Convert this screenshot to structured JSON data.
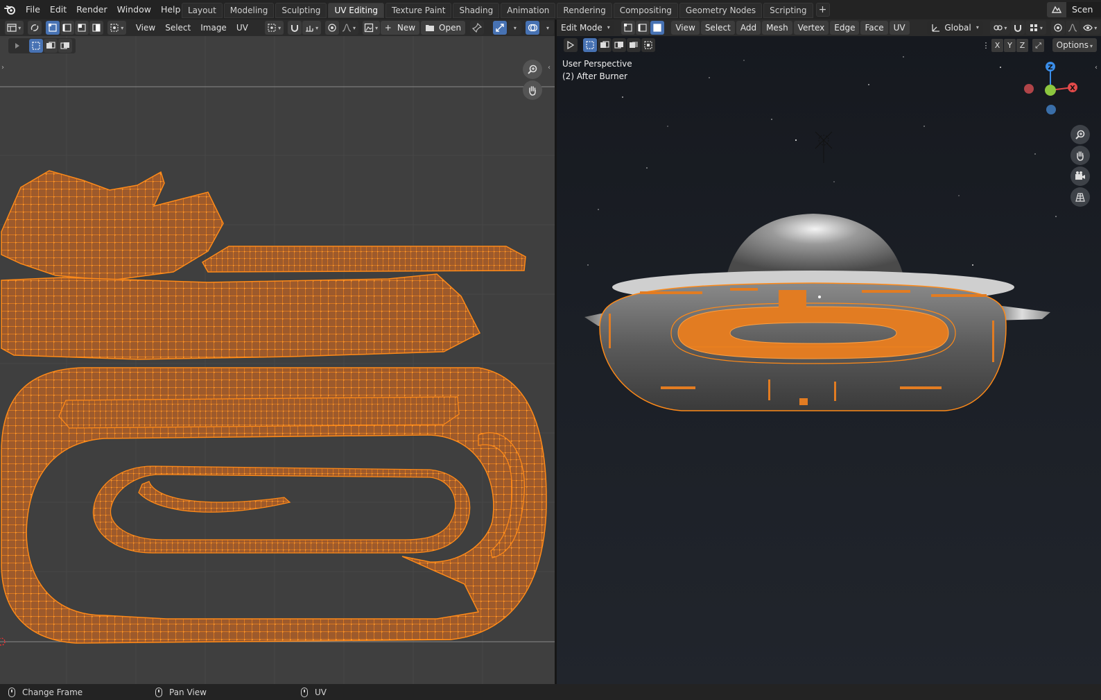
{
  "menu": {
    "file": "File",
    "edit": "Edit",
    "render": "Render",
    "window": "Window",
    "help": "Help"
  },
  "workspace_tabs": [
    {
      "label": "Layout",
      "active": false
    },
    {
      "label": "Modeling",
      "active": false
    },
    {
      "label": "Sculpting",
      "active": false
    },
    {
      "label": "UV Editing",
      "active": true
    },
    {
      "label": "Texture Paint",
      "active": false
    },
    {
      "label": "Shading",
      "active": false
    },
    {
      "label": "Animation",
      "active": false
    },
    {
      "label": "Rendering",
      "active": false
    },
    {
      "label": "Compositing",
      "active": false
    },
    {
      "label": "Geometry Nodes",
      "active": false
    },
    {
      "label": "Scripting",
      "active": false
    }
  ],
  "workspace_add": "+",
  "scene": {
    "label": "Scen"
  },
  "uv_header": {
    "view": "View",
    "select": "Select",
    "image": "Image",
    "uv": "UV",
    "new": "New",
    "new_prefix": "+",
    "open": "Open"
  },
  "viewport_header": {
    "mode": "Edit Mode",
    "view": "View",
    "select": "Select",
    "add": "Add",
    "mesh": "Mesh",
    "vertex": "Vertex",
    "edge": "Edge",
    "face": "Face",
    "uv": "UV",
    "orientation": "Global"
  },
  "viewport": {
    "perspective": "User Perspective",
    "object": "(2) After Burner",
    "axis_x": "X",
    "axis_y": "Y",
    "axis_z": "Z",
    "options": "Options",
    "gizmo": {
      "z": "Z",
      "x": "X"
    }
  },
  "status": {
    "change_frame": "Change Frame",
    "pan_view": "Pan View",
    "uv": "UV"
  },
  "colors": {
    "accent_blue": "#4772b3",
    "uv_face": "#a0592a",
    "uv_edge": "#ff8c1a",
    "uv_vertex": "#ff9b29",
    "axis_x": "#e34a4a",
    "axis_y": "#8cc63f",
    "axis_z": "#3a8de8"
  },
  "icons": [
    "blender-logo-icon",
    "editor-type-icon",
    "sync-selection-icon",
    "vertex-select-icon",
    "edge-select-icon",
    "face-select-icon",
    "island-select-icon",
    "sticky-select-icon",
    "pivot-icon",
    "snap-icon",
    "proportional-icon",
    "image-browse-icon",
    "new-image-icon",
    "open-folder-icon",
    "pin-icon",
    "gizmo-icon",
    "overlay-icon",
    "zoom-icon",
    "hand-pan-icon",
    "camera-icon",
    "grid-icon",
    "select-box-icon",
    "transform-orientation-icon",
    "mouse-left-icon",
    "mouse-middle-icon",
    "mouse-right-icon"
  ]
}
